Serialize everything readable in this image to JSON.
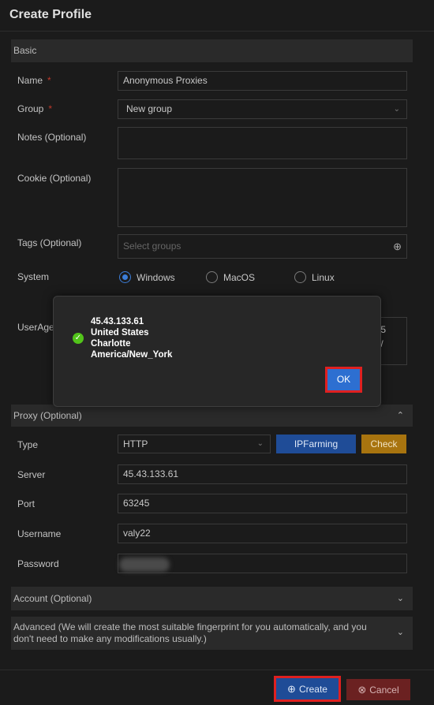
{
  "window": {
    "title": "Create Profile"
  },
  "basic": {
    "header": "Basic",
    "name_label": "Name",
    "name_value": "Anonymous Proxies",
    "group_label": "Group",
    "group_value": "New group",
    "notes_label": "Notes (Optional)",
    "cookie_label": "Cookie (Optional)",
    "tags_label": "Tags (Optional)",
    "tags_placeholder": "Select groups",
    "system_label": "System",
    "system_options": [
      "Windows",
      "MacOS",
      "Linux"
    ],
    "system_selected": "Windows",
    "useragent_label": "UserAgent",
    "useragent_partial_right": "5\n/"
  },
  "proxy": {
    "header": "Proxy (Optional)",
    "type_label": "Type",
    "type_value": "HTTP",
    "ipfarming_label": "IPFarming",
    "check_label": "Check",
    "server_label": "Server",
    "server_value": "45.43.133.61",
    "port_label": "Port",
    "port_value": "63245",
    "username_label": "Username",
    "username_value": "valy22",
    "password_label": "Password"
  },
  "account": {
    "header": "Account (Optional)"
  },
  "advanced": {
    "header": "Advanced (We will create the most suitable fingerprint for you automatically, and you don't need to make any modifications usually.)"
  },
  "footer": {
    "create_label": "Create",
    "cancel_label": "Cancel"
  },
  "modal": {
    "line1": "45.43.133.61",
    "line2": "United States",
    "line3": "Charlotte",
    "line4": "America/New_York",
    "ok_label": "OK"
  },
  "colors": {
    "accent": "#2d6fd1",
    "check_button": "#a8740f",
    "cancel_button": "#8b2a2a",
    "highlight": "#e02020",
    "success": "#52c41a",
    "required": "#c0392b"
  }
}
